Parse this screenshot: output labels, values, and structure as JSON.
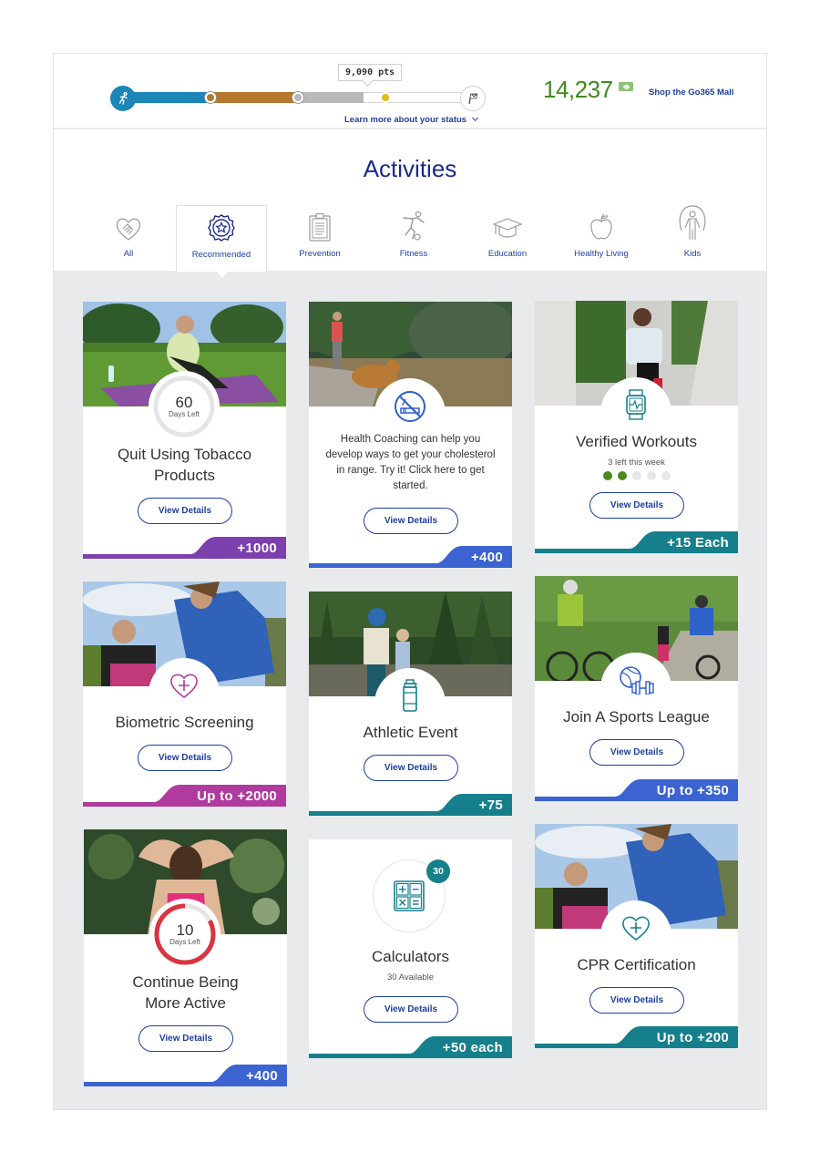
{
  "status": {
    "points_bubble": "9,090 pts",
    "learn_more": "Learn more about your status",
    "progress_fraction_in_current_tier": 0.55,
    "tiers": [
      "Blue",
      "Bronze",
      "Silver",
      "Gold",
      "Platinum"
    ],
    "colors": {
      "blue": "#1b86b7",
      "bronze": "#b5782e",
      "silver": "#b8b8b8",
      "gold": "#e2bb1c"
    }
  },
  "points_total": "14,237",
  "shop_link": "Shop the Go365 Mall",
  "page_title": "Activities",
  "tabs": [
    {
      "label": "All",
      "icon": "handshake-heart-icon",
      "active": false
    },
    {
      "label": "Recommended",
      "icon": "award-badge-icon",
      "active": true
    },
    {
      "label": "Prevention",
      "icon": "clipboard-icon",
      "active": false
    },
    {
      "label": "Fitness",
      "icon": "soccer-player-icon",
      "active": false
    },
    {
      "label": "Education",
      "icon": "graduation-cap-icon",
      "active": false
    },
    {
      "label": "Healthy Living",
      "icon": "apple-icon",
      "active": false
    },
    {
      "label": "Kids",
      "icon": "jump-rope-kid-icon",
      "active": false
    }
  ],
  "cards": [
    {
      "title": "Quit Using Tobacco Products",
      "title_line1": "Quit Using Tobacco",
      "title_line2": "Products",
      "days_left": "60",
      "days_label": "Days Left",
      "days_progress": 0,
      "button": "View Details",
      "reward": "+1000",
      "reward_color": "#7b3fae",
      "photo": "woman stretching on yoga mat in park"
    },
    {
      "description": "Health Coaching can help you develop ways to get your cholesterol in range. Try it! Click here to get started.",
      "icon": "no-smoking-icon",
      "button": "View Details",
      "reward": "+400",
      "reward_color": "#3b63d1",
      "photo": "man fishing with golden retriever"
    },
    {
      "title": "Verified Workouts",
      "subtitle": "3 left this week",
      "icon": "smartwatch-icon",
      "workouts_done": 2,
      "workouts_total": 5,
      "button": "View Details",
      "reward": "+15 Each",
      "reward_color": "#167f8c",
      "photo": "man running up stairs"
    },
    {
      "title": "Biometric Screening",
      "icon": "heart-plus-icon",
      "button": "View Details",
      "reward": "Up to +2000",
      "reward_color": "#b03a9e",
      "photo": "two people stretching outdoors"
    },
    {
      "title": "Athletic Event",
      "icon": "water-bottle-icon",
      "button": "View Details",
      "reward": "+75",
      "reward_color": "#167f8c",
      "photo": "hikers in forest"
    },
    {
      "title": "Join A Sports League",
      "icon": "ball-dumbbell-icon",
      "button": "View Details",
      "reward": "Up to +350",
      "reward_color": "#3b63d1",
      "photo": "cyclists on trail"
    },
    {
      "title": "Continue Being More Active",
      "title_line1": "Continue Being",
      "title_line2": "More Active",
      "days_left": "10",
      "days_label": "Days Left",
      "days_progress": 0.83,
      "button": "View Details",
      "reward": "+400",
      "reward_color": "#3b63d1",
      "photo": "woman stretching arms behind head"
    },
    {
      "title": "Calculators",
      "subtitle": "30 Available",
      "count_badge": "30",
      "icon": "calculator-icon",
      "button": "View Details",
      "reward": "+50 each",
      "reward_color": "#167f8c"
    },
    {
      "title": "CPR Certification",
      "icon": "heart-plus-icon",
      "button": "View Details",
      "reward": "Up to +200",
      "reward_color": "#167f8c",
      "photo": "two people stretching outdoors"
    }
  ]
}
